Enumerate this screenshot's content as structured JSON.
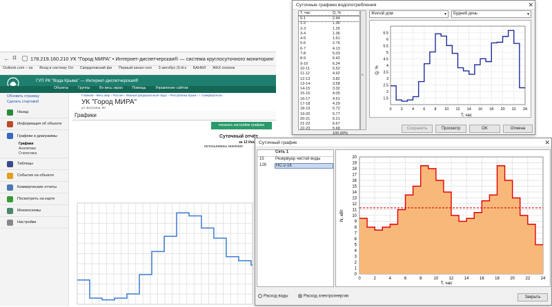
{
  "browser": {
    "url_text": "178.219.160.210  УК \"Город МИРА\" • Интернет-диспетчерская® — система круглосуточного мониторинг",
    "bookmarks": [
      "Outlook.com – sa",
      "Вход в систему Ол",
      "Свердловский фи",
      "Первый канал онл",
      "3 автобус (5-й к",
      "БАНКИ",
      "ЖКХ платеж"
    ],
    "site_header": "ГУП РК \"Вода Крыма\" — Интернет-диспетчерская®",
    "menu": [
      "Объекты",
      "Группы",
      "Во весь экран",
      "Помощь",
      "Управление сайтом"
    ],
    "top_links": [
      "Обновить страницу",
      "Сделать стартовой"
    ],
    "breadcrumb": "Главная › Весь мир › Россия › Южный федеральный округ › Республика Крым › г. Симферополь",
    "page_title": "УК \"Город МИРА\"",
    "address": "ул. Ватутина, 60",
    "section_title": "Графики",
    "settings_button": "показать настройки графика",
    "chart_title": "Суточный отчёт",
    "chart_subtitle": "за 12 Июля 2",
    "chart_note": "использованы значения"
  },
  "sidebar": {
    "items": [
      {
        "label": "Назад",
        "color": "#2a8a3a"
      },
      {
        "label": "Информация об объекте",
        "color": "#b84a2a"
      },
      {
        "label": "Графики и диаграммы",
        "color": "#3a6ac0"
      },
      {
        "label": "Таблицы",
        "color": "#3a4a8a"
      },
      {
        "label": "События на объекте",
        "color": "#e0a020"
      },
      {
        "label": "Коммерческие отчеты",
        "color": "#4a7ab0"
      },
      {
        "label": "Посмотреть на карте",
        "color": "#3a9a3a"
      },
      {
        "label": "Мнемосхемы",
        "color": "#4a8a6a"
      },
      {
        "label": "Настройки",
        "color": "#888888"
      }
    ],
    "subitems": [
      "Графики",
      "Аналитика",
      "Статистика"
    ]
  },
  "win1": {
    "title": "Суточные графики водопотребления",
    "col_time": "T, час",
    "col_q": "Q, %",
    "rows": [
      [
        "0-1",
        "2.44"
      ],
      [
        "1-2",
        "1.36"
      ],
      [
        "2-3",
        "1.26"
      ],
      [
        "3-4",
        "1.36"
      ],
      [
        "4-5",
        "1.61"
      ],
      [
        "5-6",
        "2.76"
      ],
      [
        "6-7",
        "4.13"
      ],
      [
        "7-8",
        "5.03"
      ],
      [
        "8-9",
        "6.42"
      ],
      [
        "9-10",
        "6.24"
      ],
      [
        "10-11",
        "5.52"
      ],
      [
        "11-12",
        "4.92"
      ],
      [
        "12-13",
        "3.82"
      ],
      [
        "13-14",
        "3.58"
      ],
      [
        "14-15",
        "3.32"
      ],
      [
        "15-16",
        "4.05"
      ],
      [
        "16-17",
        "4.51"
      ],
      [
        "17-18",
        "4.29"
      ],
      [
        "18-19",
        "5.72"
      ],
      [
        "19-20",
        "5.77"
      ],
      [
        "20-21",
        "6.21"
      ],
      [
        "21-22",
        "6.67"
      ],
      [
        "22-23",
        "5.68"
      ],
      [
        "23-24",
        "2.29"
      ]
    ],
    "total": "100.00%",
    "select1": "Жилой дом",
    "select2": "Будний день",
    "buttons": [
      "Сохранить",
      "Просмотр",
      "OK",
      "Отмена"
    ],
    "ylabel": "Q, %",
    "xlabel": "T, час"
  },
  "win2": {
    "title": "Суточный график",
    "list_header": "Сеть 1",
    "list": [
      {
        "id": "15",
        "name": "Резервуар чистой воды"
      },
      {
        "id": "128",
        "name": "НС-2-16"
      }
    ],
    "radio1": "Расход воды",
    "radio2": "Расход электроэнергии",
    "close_button": "Закрыть",
    "ylabel": "N, кВт",
    "xlabel": "T, час"
  },
  "chart_data": [
    {
      "type": "line",
      "title": "",
      "xlabel": "T, час",
      "ylabel": "Q, %",
      "xlim": [
        0,
        24
      ],
      "ylim": [
        1,
        7
      ],
      "x": [
        0,
        1,
        2,
        3,
        4,
        5,
        6,
        7,
        8,
        9,
        10,
        11,
        12,
        13,
        14,
        15,
        16,
        17,
        18,
        19,
        20,
        21,
        22,
        23
      ],
      "values": [
        2.44,
        1.36,
        1.26,
        1.36,
        1.61,
        2.76,
        4.13,
        5.03,
        6.42,
        6.24,
        5.52,
        4.92,
        3.82,
        3.58,
        3.32,
        4.05,
        4.51,
        4.29,
        5.72,
        5.77,
        6.21,
        6.67,
        5.68,
        2.29
      ],
      "color": "#1a2a9a"
    },
    {
      "type": "area",
      "title": "",
      "xlabel": "T, час",
      "ylabel": "N, кВт",
      "xlim": [
        0,
        24
      ],
      "ylim": [
        0,
        20
      ],
      "x": [
        0,
        1,
        2,
        3,
        4,
        5,
        6,
        7,
        8,
        9,
        10,
        11,
        12,
        13,
        14,
        15,
        16,
        17,
        18,
        19,
        20,
        21,
        22,
        23
      ],
      "values": [
        9.5,
        8,
        7.5,
        8,
        8.5,
        11,
        13.5,
        15,
        18.5,
        18,
        16,
        14,
        10,
        9,
        9.5,
        10.5,
        12.5,
        13.5,
        18.5,
        16,
        13,
        10,
        8.5,
        5
      ],
      "average": 11.3,
      "color": "#e00000",
      "fill": "#f8b87a"
    }
  ]
}
